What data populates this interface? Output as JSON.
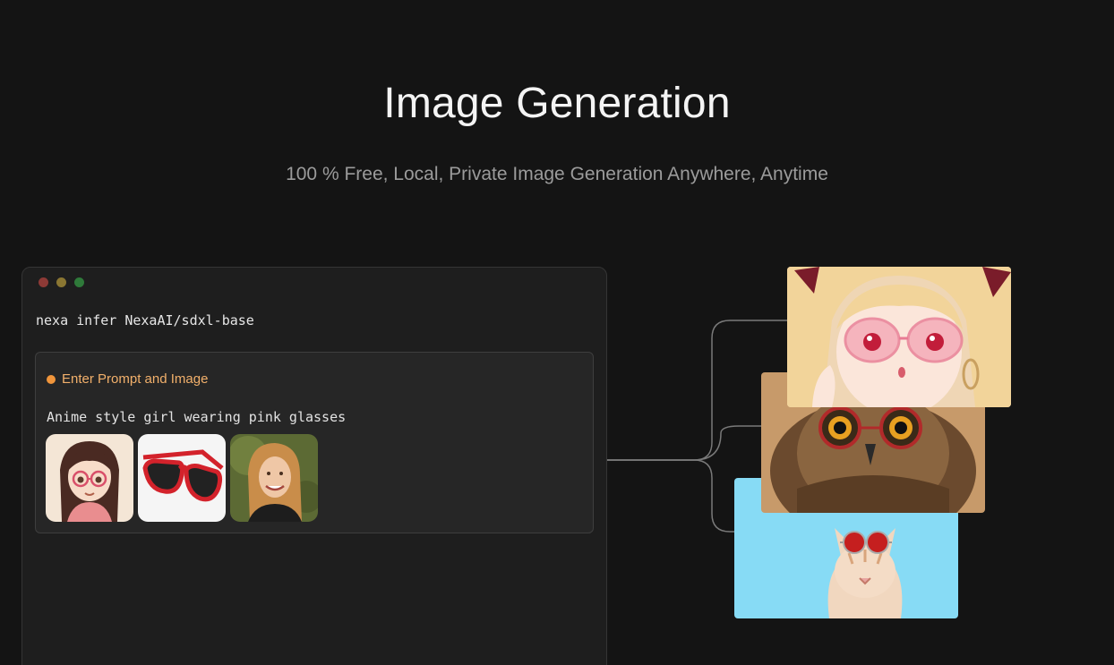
{
  "header": {
    "title": "Image Generation",
    "subtitle": "100 % Free, Local, Private Image Generation Anywhere, Anytime"
  },
  "terminal": {
    "command": "nexa infer NexaAI/sdxl-base",
    "prompt_label": "Enter Prompt and Image",
    "prompt_text": "Anime style girl wearing pink glasses",
    "input_images": [
      {
        "icon": "anime-girl-glasses-thumbnail"
      },
      {
        "icon": "red-sunglasses-thumbnail"
      },
      {
        "icon": "smiling-woman-thumbnail"
      }
    ]
  },
  "outputs": [
    {
      "icon": "anime-girl-pink-glasses-output"
    },
    {
      "icon": "owl-red-glasses-output"
    },
    {
      "icon": "cat-red-sunglasses-output"
    }
  ],
  "colors": {
    "background": "#141414",
    "accent": "#f0953b",
    "window_red": "#8d3a36",
    "window_yellow": "#8a7632",
    "window_green": "#2f7a3a"
  }
}
